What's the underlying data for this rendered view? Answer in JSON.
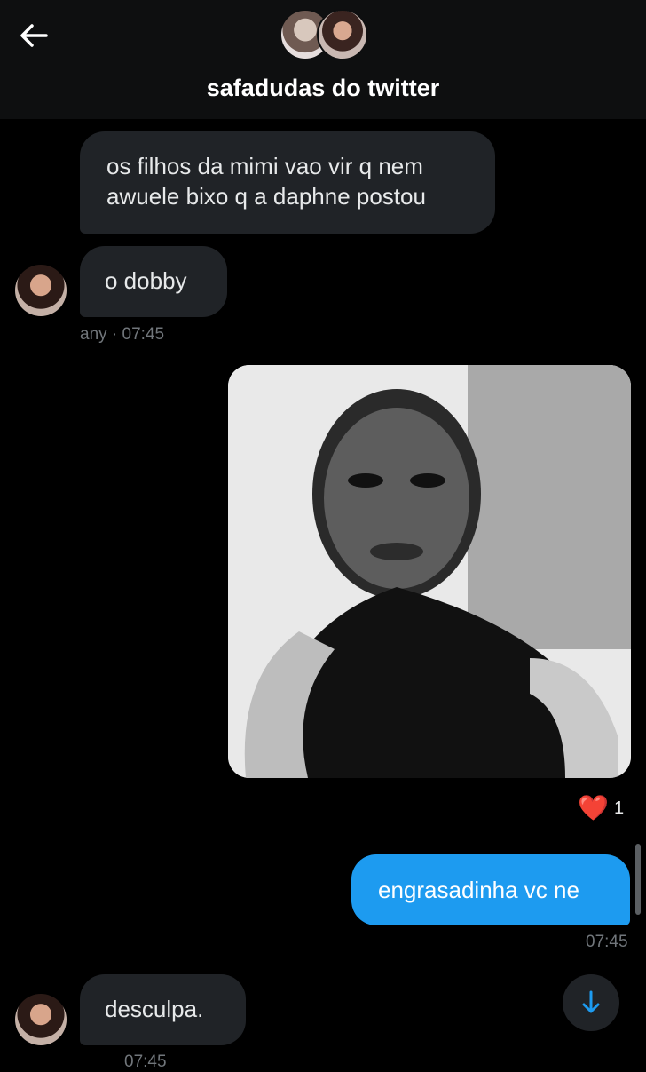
{
  "header": {
    "title": "safadudas do twitter",
    "back_icon": "arrow-left-icon"
  },
  "messages": [
    {
      "text": "os filhos da mimi vao vir q nem\nawuele bixo q a daphne postou",
      "direction": "incoming"
    },
    {
      "text": "o dobby",
      "direction": "incoming",
      "sender": "any",
      "time": "07:45"
    },
    {
      "type": "image",
      "direction": "outgoing",
      "reaction": "❤️",
      "reaction_count": "1"
    },
    {
      "text": "engrasadinha vc ne",
      "direction": "outgoing",
      "time": "07:45"
    },
    {
      "text": "desculpa.",
      "direction": "incoming",
      "time": "07:45"
    }
  ],
  "scroll_down_icon": "arrow-down-icon",
  "colors": {
    "background": "#000000",
    "incoming_bubble": "#202327",
    "outgoing_bubble": "#1d9bf0",
    "meta_text": "#71767b"
  }
}
